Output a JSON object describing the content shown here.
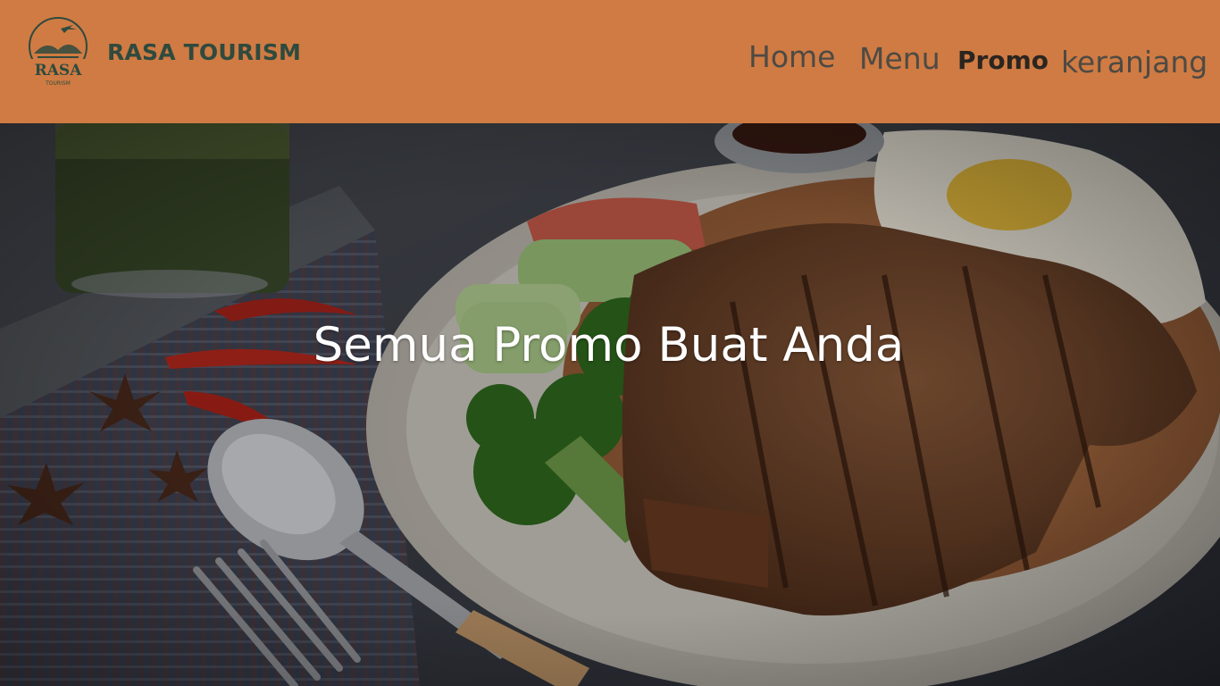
{
  "brand": {
    "name": "RASA TOURISM",
    "logo_text": "RASA",
    "logo_subtext": "TOURISM"
  },
  "nav": {
    "items": [
      {
        "label": "Home"
      },
      {
        "label": "Menu"
      },
      {
        "label": "Promo",
        "active": true
      },
      {
        "label": "keranjang"
      }
    ]
  },
  "hero": {
    "title": "Semua Promo Buat Anda",
    "image": "grilled-meat-fried-rice-plate-photo"
  },
  "colors": {
    "header_bg": "#cf7b43",
    "brand_text": "#2f4a3e",
    "nav_text": "#4d4a44",
    "nav_active": "#2a2520",
    "hero_text": "#ffffff"
  }
}
